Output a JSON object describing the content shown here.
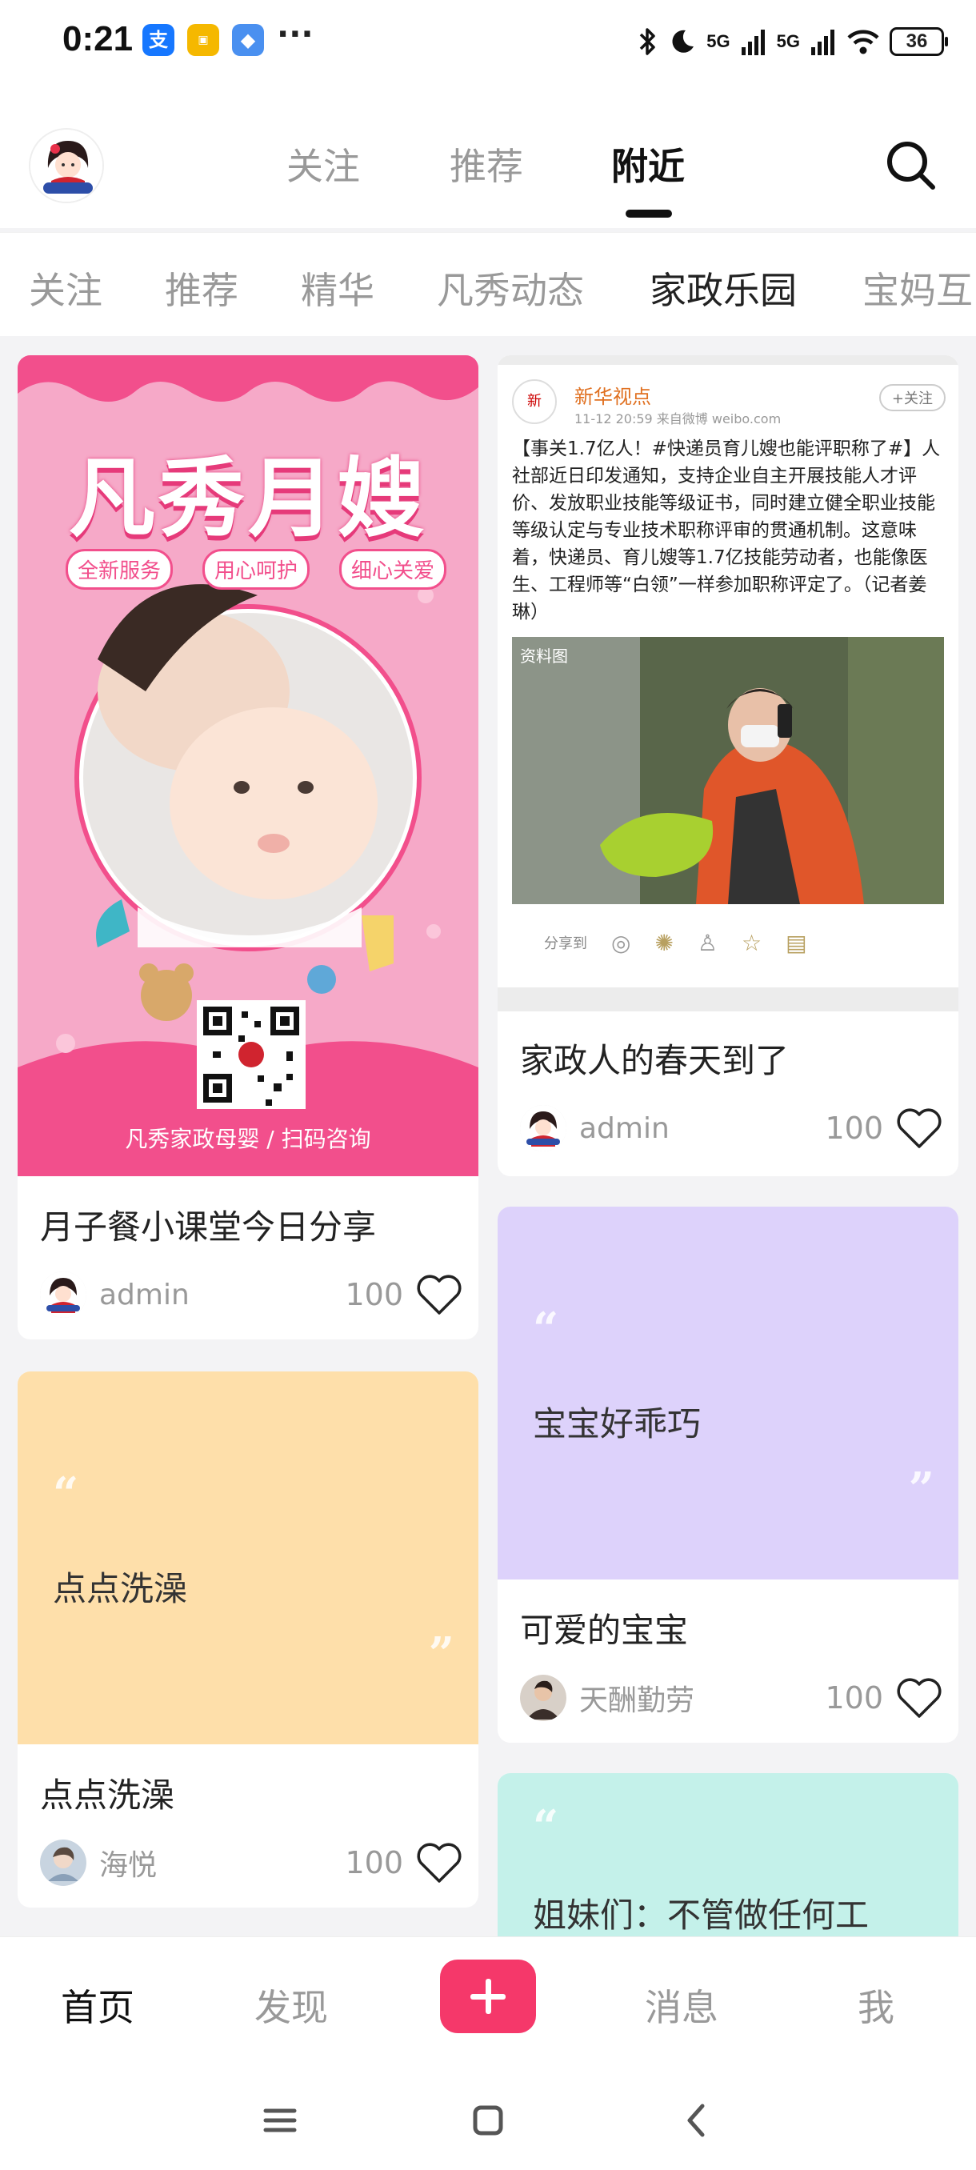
{
  "status_bar": {
    "time": "0:21",
    "app_icons": [
      {
        "name": "alipay-icon",
        "glyph": "支",
        "color": "#1677ff"
      },
      {
        "name": "app-badge-icon",
        "glyph": "▣",
        "color": "#f5b800"
      },
      {
        "name": "tshirt-icon",
        "glyph": "◆",
        "color": "#4a90f0"
      }
    ],
    "more": "···",
    "signal_1": "5G",
    "signal_2": "5G",
    "battery": "36"
  },
  "header": {
    "tabs": [
      {
        "label": "关注",
        "active": false
      },
      {
        "label": "推荐",
        "active": false
      },
      {
        "label": "附近",
        "active": true
      }
    ],
    "search_icon": "search-icon"
  },
  "categories": [
    {
      "label": "关注",
      "active": false
    },
    {
      "label": "推荐",
      "active": false
    },
    {
      "label": "精华",
      "active": false
    },
    {
      "label": "凡秀动态",
      "active": false
    },
    {
      "label": "家政乐园",
      "active": true
    },
    {
      "label": "宝妈互",
      "active": false
    }
  ],
  "posts": {
    "post1": {
      "poster": {
        "title": "凡秀月嫂",
        "tags": [
          "全新服务",
          "用心呵护",
          "细心关爱"
        ],
        "footer": "凡秀家政母婴 / 扫码咨询"
      },
      "title": "月子餐小课堂今日分享",
      "author": "admin",
      "likes": "100"
    },
    "post2": {
      "weibo": {
        "source": "新华视点",
        "meta": "11-12 20:59  来自微博 weibo.com",
        "follow": "+关注",
        "body": "【事关1.7亿人！#快递员育儿嫂也能评职称了#】人社部近日印发通知，支持企业自主开展技能人才评价、发放职业技能等级证书，同时建立健全职业技能等级认定与专业技术职称评审的贯通机制。这意味着，快递员、育儿嫂等1.7亿技能劳动者，也能像医生、工程师等“白领”一样参加职称评定了。（记者姜琳）",
        "photo_label": "资料图",
        "share": "分享到"
      },
      "title": "家政人的春天到了",
      "author": "admin",
      "likes": "100"
    },
    "post3": {
      "quote": "点点洗澡",
      "title": "点点洗澡",
      "author": "海悦",
      "likes": "100",
      "bg": "#fedfaa"
    },
    "post4": {
      "quote": "宝宝好乖巧",
      "title": "可爱的宝宝",
      "author": "天酬勤劳",
      "likes": "100",
      "bg": "#ddd2fb"
    },
    "post5": {
      "quote": "姐妹们：不管做任何工",
      "bg": "#c4f1ea"
    }
  },
  "bottom_nav": [
    {
      "label": "首页",
      "active": true
    },
    {
      "label": "发现",
      "active": false
    },
    {
      "label": "消息",
      "active": false
    },
    {
      "label": "我",
      "active": false
    }
  ],
  "colors": {
    "accent": "#f5386a",
    "poster_pink": "#f6a9c8",
    "poster_dark": "#f24f8c"
  }
}
